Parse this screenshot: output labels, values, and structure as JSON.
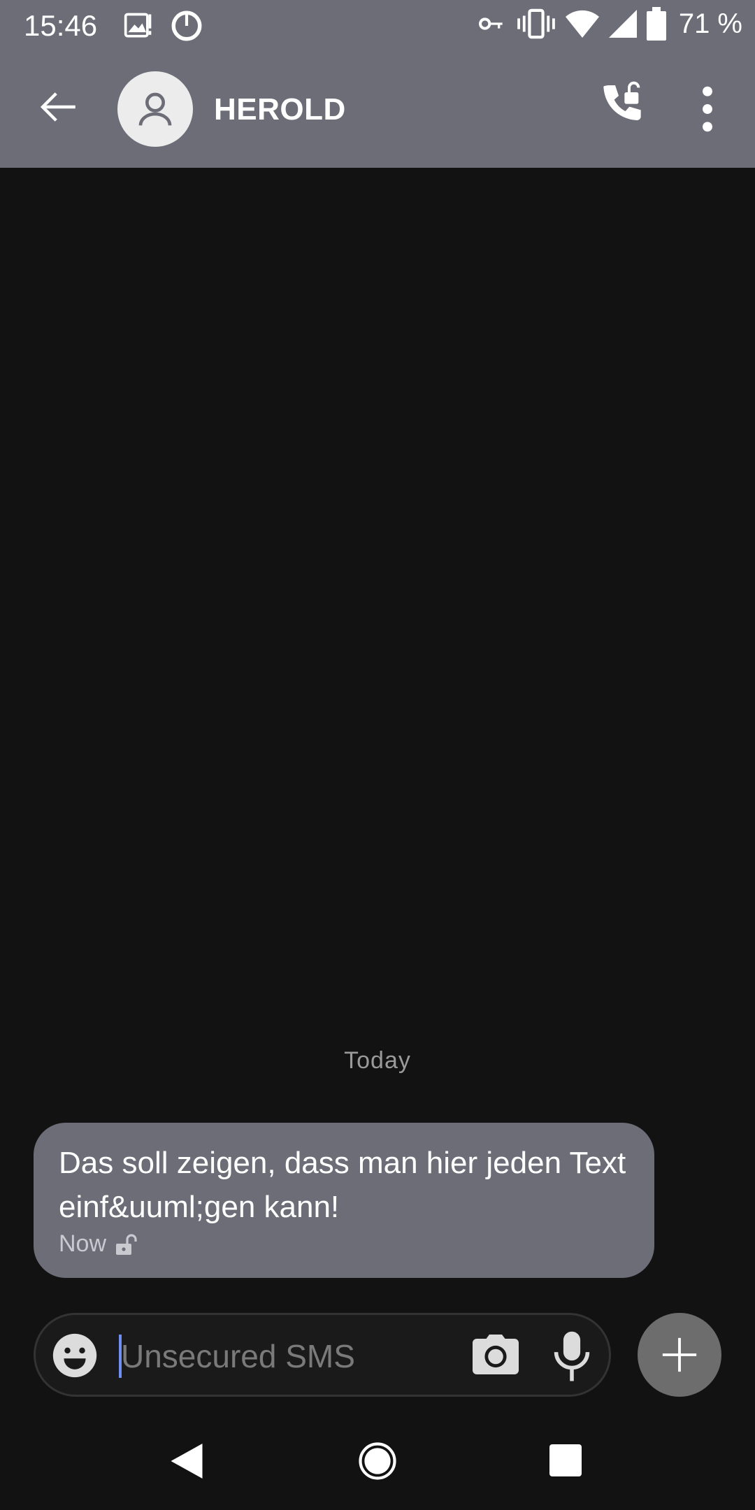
{
  "status_bar": {
    "time": "15:46",
    "battery_percent": "71 %",
    "icons": [
      "image-notification-icon",
      "sync-icon",
      "vpn-key-icon",
      "vibrate-icon",
      "wifi-icon",
      "signal-icon",
      "battery-icon"
    ]
  },
  "header": {
    "contact_name": "HEROLD"
  },
  "conversation": {
    "date_divider": "Today",
    "messages": [
      {
        "text": "Das soll zeigen, dass man hier jeden Text einf&uuml;gen kann!",
        "time": "Now",
        "secured": false
      }
    ]
  },
  "composer": {
    "placeholder": "Unsecured SMS",
    "value": ""
  },
  "colors": {
    "toolbar": "#6d6d78",
    "background": "#121212",
    "bubble": "#6d6d78",
    "send_button": "#6d6d6d",
    "cursor": "#6f8ff5"
  }
}
